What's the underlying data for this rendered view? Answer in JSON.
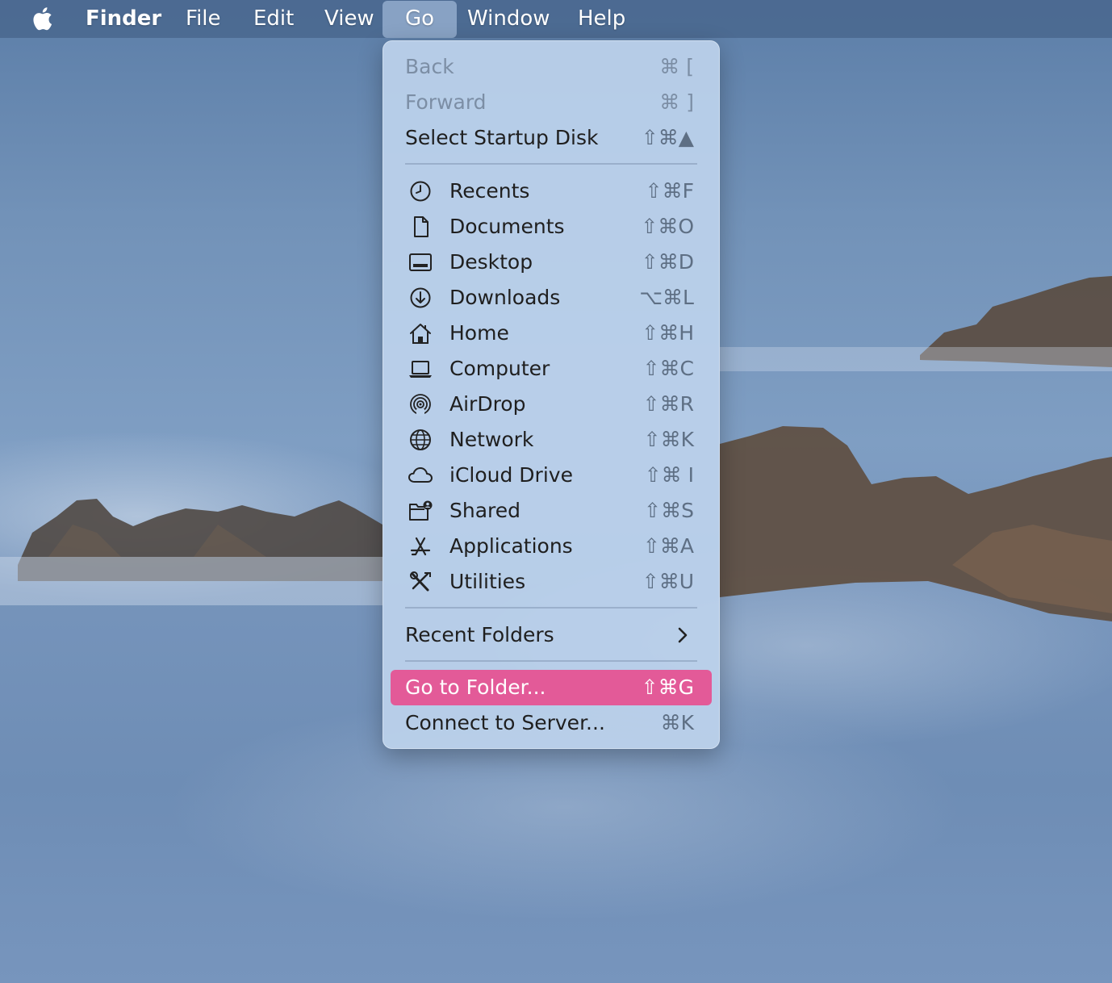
{
  "menubar": {
    "app_name": "Finder",
    "items": [
      "File",
      "Edit",
      "View",
      "Go",
      "Window",
      "Help"
    ],
    "active": "Go"
  },
  "go_menu": {
    "nav": [
      {
        "label": "Back",
        "shortcut": "⌘ [",
        "enabled": false
      },
      {
        "label": "Forward",
        "shortcut": "⌘ ]",
        "enabled": false
      },
      {
        "label": "Select Startup Disk",
        "shortcut": "⇧⌘▲",
        "enabled": true
      }
    ],
    "locations": [
      {
        "label": "Recents",
        "shortcut": "⇧⌘F",
        "icon": "clock-icon"
      },
      {
        "label": "Documents",
        "shortcut": "⇧⌘O",
        "icon": "document-icon"
      },
      {
        "label": "Desktop",
        "shortcut": "⇧⌘D",
        "icon": "desktop-icon"
      },
      {
        "label": "Downloads",
        "shortcut": "⌥⌘L",
        "icon": "download-icon"
      },
      {
        "label": "Home",
        "shortcut": "⇧⌘H",
        "icon": "home-icon"
      },
      {
        "label": "Computer",
        "shortcut": "⇧⌘C",
        "icon": "laptop-icon"
      },
      {
        "label": "AirDrop",
        "shortcut": "⇧⌘R",
        "icon": "airdrop-icon"
      },
      {
        "label": "Network",
        "shortcut": "⇧⌘K",
        "icon": "globe-icon"
      },
      {
        "label": "iCloud Drive",
        "shortcut": "⇧⌘ I",
        "icon": "cloud-icon"
      },
      {
        "label": "Shared",
        "shortcut": "⇧⌘S",
        "icon": "shared-folder-icon"
      },
      {
        "label": "Applications",
        "shortcut": "⇧⌘A",
        "icon": "applications-icon"
      },
      {
        "label": "Utilities",
        "shortcut": "⇧⌘U",
        "icon": "utilities-icon"
      }
    ],
    "recent_folders": {
      "label": "Recent Folders"
    },
    "go_to_folder": {
      "label": "Go to Folder...",
      "shortcut": "⇧⌘G",
      "highlighted": true
    },
    "connect_to_server": {
      "label": "Connect to Server...",
      "shortcut": "⌘K"
    }
  },
  "colors": {
    "highlight": "#e35a98",
    "menu_bg": "#bcd2ec",
    "menubar_bg": "#4a688e"
  }
}
